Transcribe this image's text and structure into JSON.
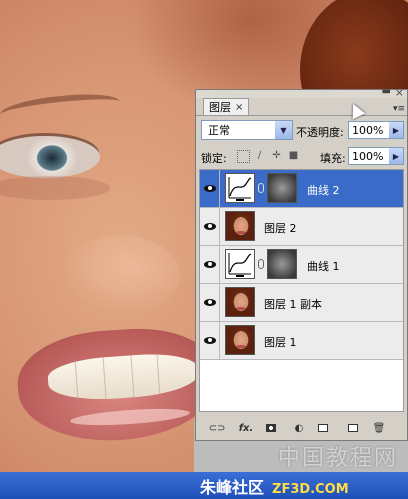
{
  "panel": {
    "tab_label": "图层",
    "tab_close": "×",
    "panel_minimize": "▬",
    "panel_close": "×",
    "menu_icon": "▾≡",
    "blend_mode": "正常",
    "opacity_label": "不透明度:",
    "opacity_value": "100%",
    "lock_label": "锁定:",
    "fill_label": "填充:",
    "fill_value": "100%",
    "layers": [
      {
        "name": "曲线 2",
        "type": "curves-adjustment",
        "visible": true,
        "selected": true
      },
      {
        "name": "图层 2",
        "type": "image",
        "visible": true,
        "selected": false
      },
      {
        "name": "曲线 1",
        "type": "curves-adjustment",
        "visible": true,
        "selected": false
      },
      {
        "name": "图层 1 副本",
        "type": "image",
        "visible": true,
        "selected": false
      },
      {
        "name": "图层 1",
        "type": "image",
        "visible": true,
        "selected": false
      }
    ],
    "toolbar_icons": [
      "link-icon",
      "fx-icon",
      "add-mask-icon",
      "adjustment-layer-icon",
      "new-group-icon",
      "new-layer-icon",
      "trash-icon"
    ],
    "fx_label": "fx."
  },
  "watermark": {
    "chinese": "中国教程网",
    "site_name": "朱峰社区",
    "site_url": "ZF3D.COM"
  },
  "colors": {
    "selection": "#3a6bc8",
    "taskbar": "#1f4fb8"
  }
}
